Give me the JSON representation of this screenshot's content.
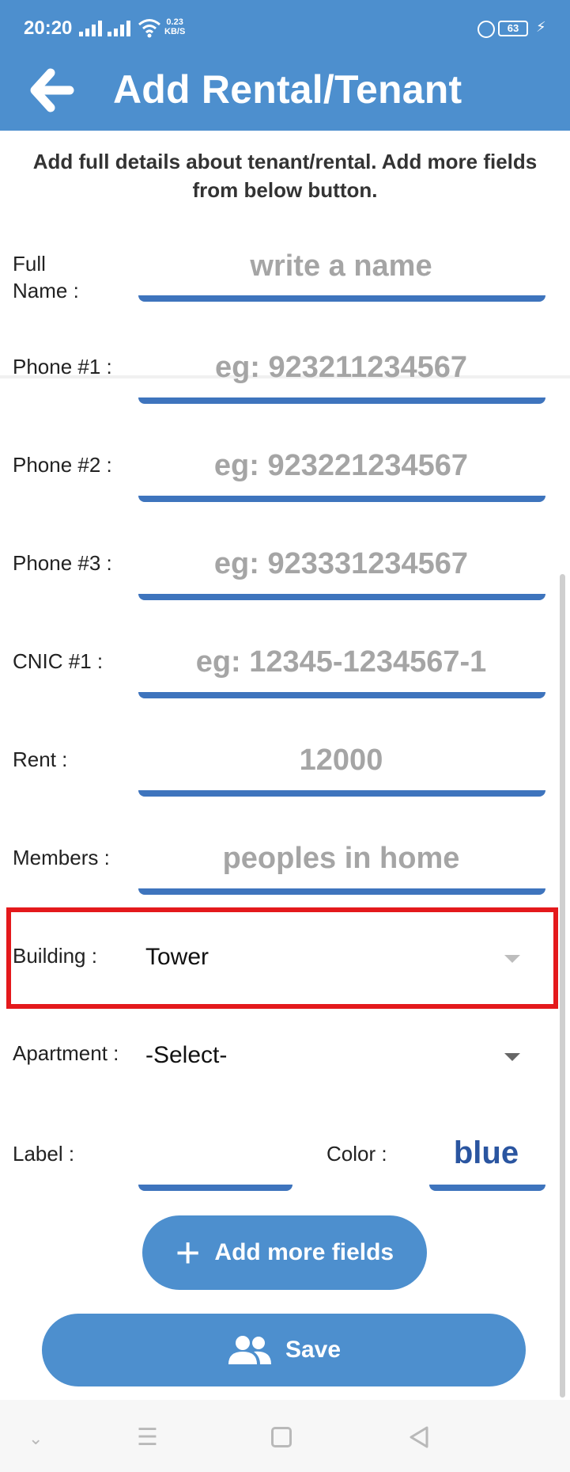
{
  "status_bar": {
    "time": "20:20",
    "net_speed_value": "0.23",
    "net_speed_unit": "KB/S",
    "battery": "63"
  },
  "header": {
    "title": "Add Rental/Tenant"
  },
  "intro": {
    "line1": "Add full details about tenant/rental. Add more fields",
    "line2": "from below button."
  },
  "form": {
    "full_name": {
      "label_line1": "Full",
      "label_line2": "Name :",
      "placeholder": "write a name"
    },
    "phone1": {
      "label": "Phone #1 :",
      "placeholder": "eg: 923211234567"
    },
    "phone2": {
      "label": "Phone #2 :",
      "placeholder": "eg: 923221234567"
    },
    "phone3": {
      "label": "Phone #3 :",
      "placeholder": "eg: 923331234567"
    },
    "cnic1": {
      "label": "CNIC #1 :",
      "placeholder": "eg: 12345-1234567-1"
    },
    "rent": {
      "label": "Rent :",
      "placeholder": "12000"
    },
    "members": {
      "label": "Members :",
      "placeholder": "peoples in home"
    },
    "building": {
      "label": "Building :",
      "value": "Tower"
    },
    "apartment": {
      "label": "Apartment :",
      "value": "-Select-"
    },
    "label_field": {
      "label": "Label :",
      "value": ""
    },
    "color": {
      "label": "Color :",
      "value": "blue"
    }
  },
  "buttons": {
    "add_more": "Add more fields",
    "save": "Save"
  },
  "colors": {
    "primary": "#4d8fce",
    "underline": "#3e74bd",
    "highlight": "#e4191c",
    "color_value": "#2a55a0"
  }
}
